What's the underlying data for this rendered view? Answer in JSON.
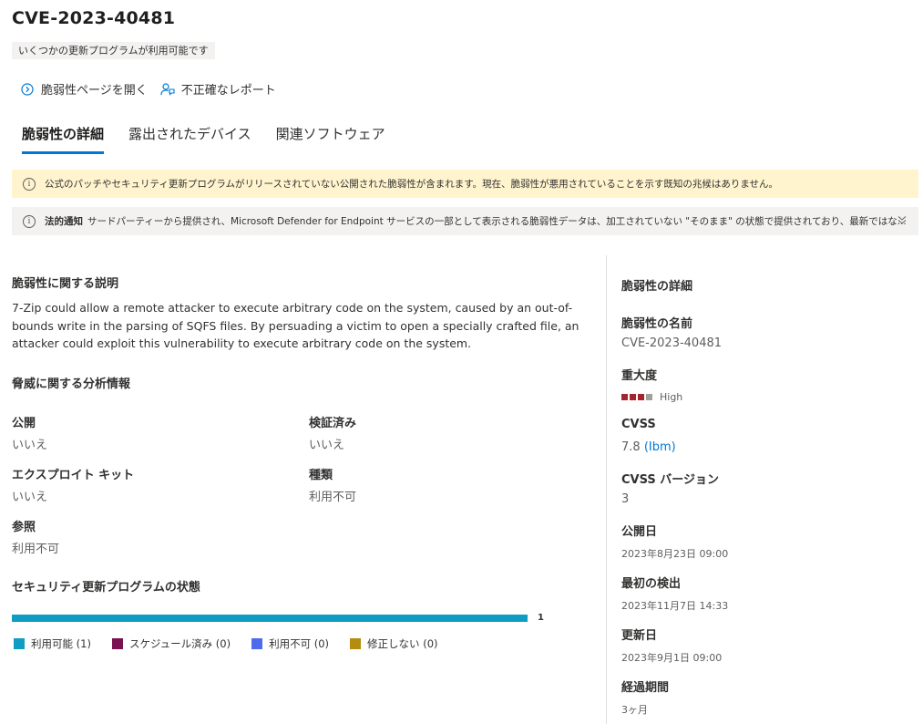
{
  "header": {
    "title": "CVE-2023-40481",
    "badge": "いくつかの更新プログラムが利用可能です"
  },
  "actions": [
    {
      "label": "脆弱性ページを開く",
      "icon": "chevron-right-circle-icon"
    },
    {
      "label": "不正確なレポート",
      "icon": "report-person-icon"
    }
  ],
  "tabs": [
    {
      "label": "脆弱性の詳細",
      "active": true
    },
    {
      "label": "露出されたデバイス",
      "active": false
    },
    {
      "label": "関連ソフトウェア",
      "active": false
    }
  ],
  "banners": {
    "warning": "公式のパッチやセキュリティ更新プログラムがリリースされていない公開された脆弱性が含まれます。現在、脆弱性が悪用されていることを示す既知の兆候はありません。",
    "legal_bold": "法的通知",
    "legal_text": "サードパーティーから提供され、Microsoft Defender for Endpoint サービスの一部として表示される脆弱性データは、加工されていない \"そのまま\" の状態で提供されており、最新ではな..."
  },
  "description": {
    "heading": "脆弱性に関する説明",
    "text": "7-Zip could allow a remote attacker to execute arbitrary code on the system, caused by an out-of-bounds write in the parsing of SQFS files. By persuading a victim to open a specially crafted file, an attacker could exploit this vulnerability to execute arbitrary code on the system."
  },
  "threat": {
    "heading": "脅威に関する分析情報",
    "public_label": "公開",
    "public_value": "いいえ",
    "verified_label": "検証済み",
    "verified_value": "いいえ",
    "exploit_label": "エクスプロイト キット",
    "exploit_value": "いいえ",
    "type_label": "種類",
    "type_value": "利用不可",
    "ref_label": "参照",
    "ref_value": "利用不可"
  },
  "update_status": {
    "heading": "セキュリティ更新プログラムの状態",
    "count": "1",
    "available_fraction": 1.0,
    "legend": [
      {
        "label": "利用可能 (1)",
        "color": "#0f9dc1"
      },
      {
        "label": "スケジュール済み (0)",
        "color": "#7a1151"
      },
      {
        "label": "利用不可 (0)",
        "color": "#4f6bed"
      },
      {
        "label": "修正しない (0)",
        "color": "#b48c0e"
      }
    ]
  },
  "details": {
    "heading": "脆弱性の詳細",
    "name_label": "脆弱性の名前",
    "name_value": "CVE-2023-40481",
    "severity_label": "重大度",
    "severity_value": "High",
    "severity_level": 3,
    "severity_max": 4,
    "severity_color": "#a4262c",
    "cvss_label": "CVSS",
    "cvss_score": "7.8",
    "cvss_source": "(Ibm)",
    "cvss_version_label": "CVSS バージョン",
    "cvss_version_value": "3",
    "published_label": "公開日",
    "published_value": "2023年8月23日 09:00",
    "first_detected_label": "最初の検出",
    "first_detected_value": "2023年11月7日 14:33",
    "updated_label": "更新日",
    "updated_value": "2023年9月1日 09:00",
    "age_label": "経過期間",
    "age_value": "3ヶ月"
  }
}
